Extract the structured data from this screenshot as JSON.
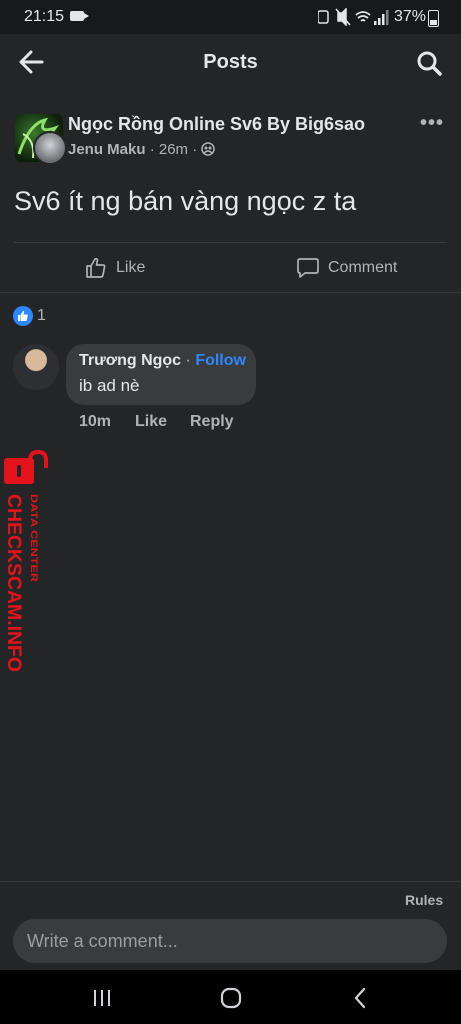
{
  "status_bar": {
    "time": "21:15",
    "battery": "37%",
    "icons": [
      "camera-icon",
      "battery-saver-icon",
      "mute-icon",
      "wifi-icon",
      "signal-icon",
      "battery-icon"
    ]
  },
  "header": {
    "title": "Posts",
    "back_icon": "back-arrow-icon",
    "search_icon": "search-icon"
  },
  "post": {
    "group_name": "Ngọc Rồng Online Sv6 By Big6sao",
    "author": "Jenu Maku",
    "time": "26m",
    "separator": "·",
    "privacy_icon": "group-icon",
    "text": "Sv6 ít ng bán vàng ngọc z ta",
    "like_label": "Like",
    "comment_label": "Comment",
    "reaction_count": "1"
  },
  "comment": {
    "author": "Trương Ngọc",
    "separator": "·",
    "follow_label": "Follow",
    "text": "ib ad nè",
    "time": "10m",
    "like_label": "Like",
    "reply_label": "Reply"
  },
  "watermark": {
    "main": "CHECKSCAM.INFO",
    "sub": "DATA CENTER"
  },
  "composer": {
    "rules_label": "Rules",
    "placeholder": "Write a comment..."
  },
  "colors": {
    "background": "#242526",
    "accent": "#2d88ff",
    "watermark": "#e4131b"
  }
}
